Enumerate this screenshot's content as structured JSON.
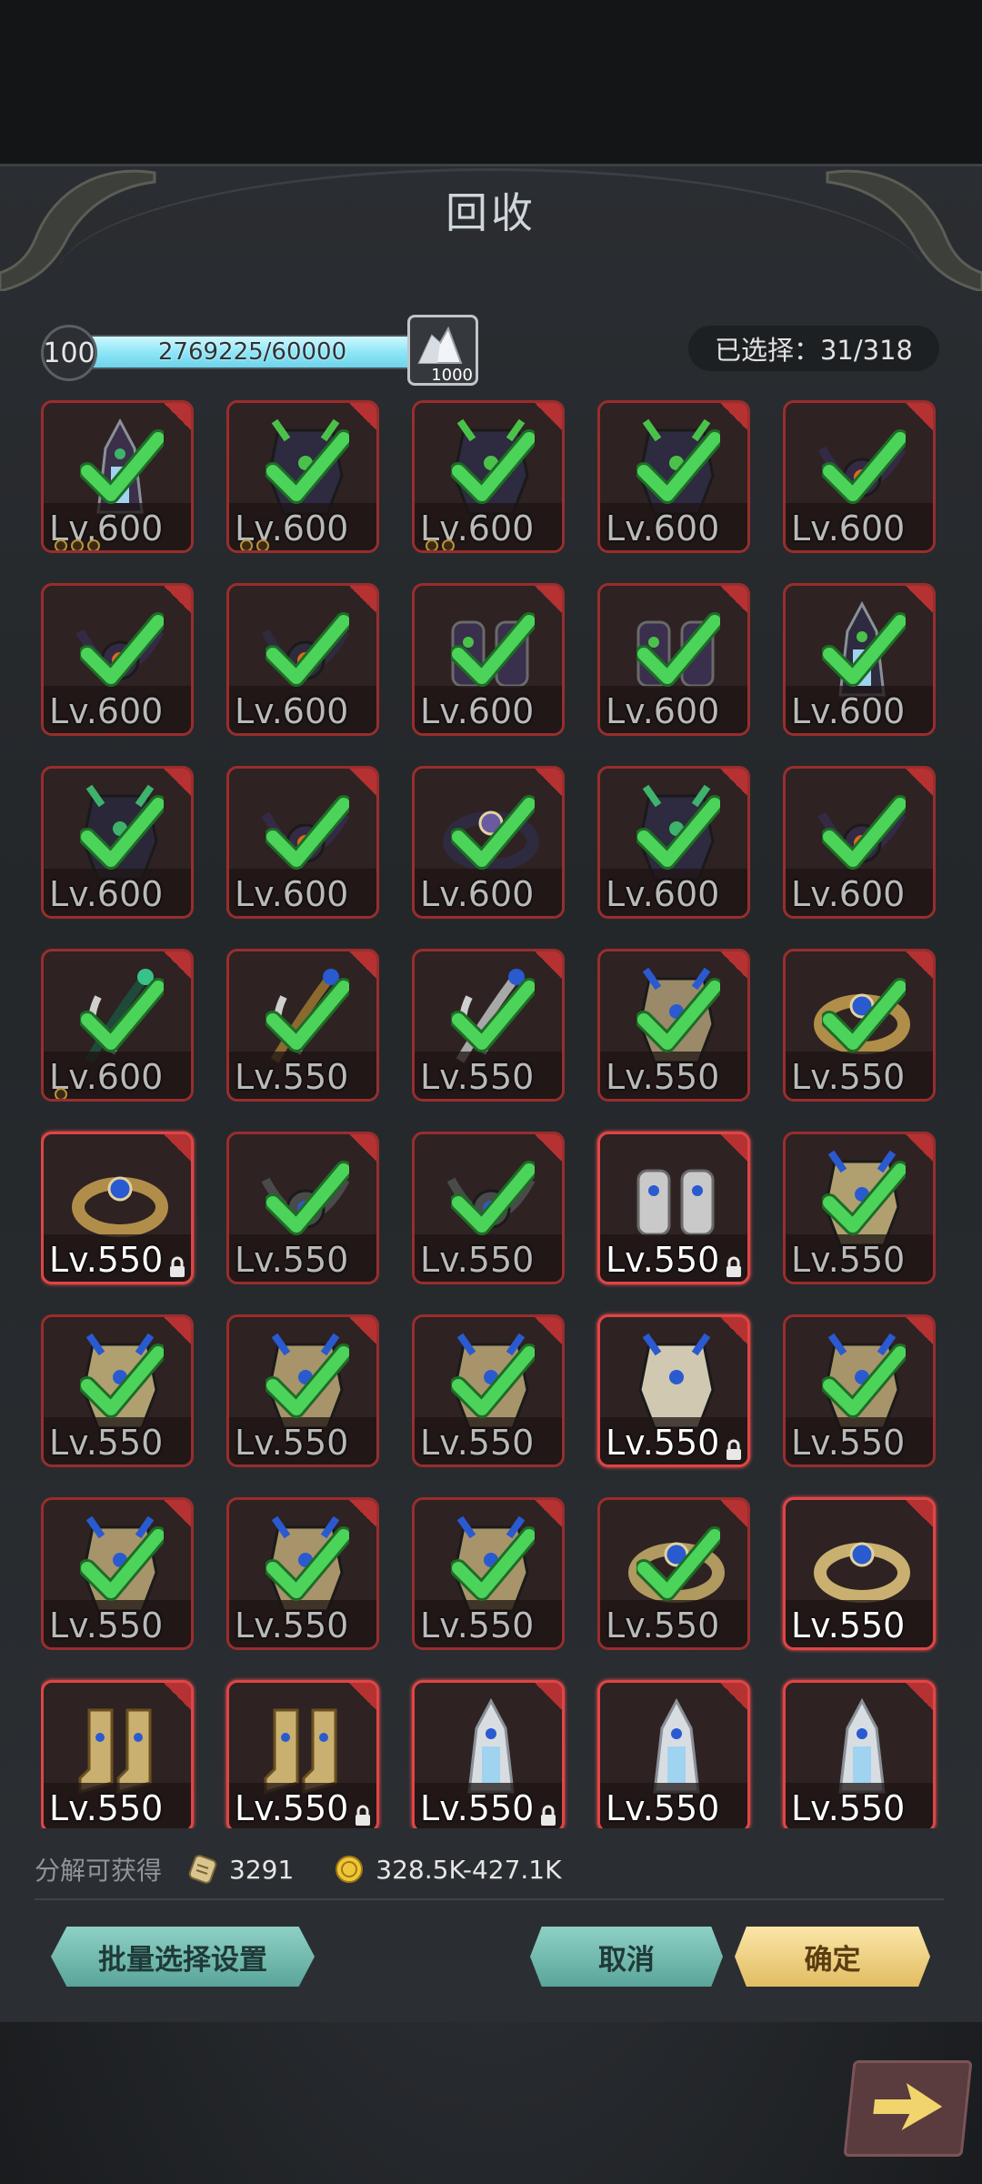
{
  "header": {
    "title": "回收"
  },
  "progress": {
    "level": "100",
    "text": "2769225/60000",
    "fill_fraction": 1.0
  },
  "crystal": {
    "icon": "white-crystal-icon",
    "count": "1000"
  },
  "selection": {
    "label": "已选择：31/318"
  },
  "items": [
    {
      "level": "Lv.600",
      "checked": true,
      "locked": false,
      "icon": "dark-horned-helmet",
      "dots": 3,
      "palette": [
        "#3b2f4a",
        "#3db36b"
      ]
    },
    {
      "level": "Lv.600",
      "checked": true,
      "locked": false,
      "icon": "dark-armor",
      "dots": 2,
      "palette": [
        "#2e2a3f",
        "#4ac24a"
      ]
    },
    {
      "level": "Lv.600",
      "checked": true,
      "locked": false,
      "icon": "dark-armor",
      "dots": 2,
      "palette": [
        "#2e2a3f",
        "#4ac24a"
      ]
    },
    {
      "level": "Lv.600",
      "checked": true,
      "locked": false,
      "icon": "dark-armor",
      "dots": 0,
      "palette": [
        "#2e2a3f",
        "#4ac24a"
      ]
    },
    {
      "level": "Lv.600",
      "checked": true,
      "locked": false,
      "icon": "dark-orb-amulet",
      "dots": 0,
      "palette": [
        "#342a46",
        "#e06a1a"
      ]
    },
    {
      "level": "Lv.600",
      "checked": true,
      "locked": false,
      "icon": "dark-orb-amulet",
      "dots": 0,
      "palette": [
        "#342a46",
        "#e06a1a"
      ]
    },
    {
      "level": "Lv.600",
      "checked": true,
      "locked": false,
      "icon": "dark-necklace",
      "dots": 0,
      "palette": [
        "#2f2a3c",
        "#e06a1a"
      ]
    },
    {
      "level": "Lv.600",
      "checked": true,
      "locked": false,
      "icon": "dark-gauntlet",
      "dots": 0,
      "palette": [
        "#3a2f4c",
        "#4ac24a"
      ]
    },
    {
      "level": "Lv.600",
      "checked": true,
      "locked": false,
      "icon": "dark-gauntlet",
      "dots": 0,
      "palette": [
        "#3a2f4c",
        "#4ac24a"
      ]
    },
    {
      "level": "Lv.600",
      "checked": true,
      "locked": false,
      "icon": "dark-horned-helmet",
      "dots": 0,
      "palette": [
        "#2e2a3f",
        "#4ac24a"
      ]
    },
    {
      "level": "Lv.600",
      "checked": true,
      "locked": false,
      "icon": "dark-leggings",
      "dots": 0,
      "palette": [
        "#2a2838",
        "#3db36b"
      ]
    },
    {
      "level": "Lv.600",
      "checked": true,
      "locked": false,
      "icon": "dark-orb-amulet",
      "dots": 0,
      "palette": [
        "#342a46",
        "#e06a1a"
      ]
    },
    {
      "level": "Lv.600",
      "checked": true,
      "locked": false,
      "icon": "dark-belt",
      "dots": 0,
      "palette": [
        "#2e2a3f",
        "#6a5aa0"
      ]
    },
    {
      "level": "Lv.600",
      "checked": true,
      "locked": false,
      "icon": "dark-chest",
      "dots": 0,
      "palette": [
        "#2e2a3f",
        "#3db36b"
      ]
    },
    {
      "level": "Lv.600",
      "checked": true,
      "locked": false,
      "icon": "dark-orb-amulet",
      "dots": 0,
      "palette": [
        "#342a46",
        "#e06a1a"
      ]
    },
    {
      "level": "Lv.600",
      "checked": true,
      "locked": false,
      "icon": "green-blade",
      "dots": 1,
      "palette": [
        "#1f4a3a",
        "#38c28a"
      ]
    },
    {
      "level": "Lv.550",
      "checked": true,
      "locked": false,
      "icon": "gold-staff",
      "dots": 0,
      "palette": [
        "#8a6a2e",
        "#2a5ad0"
      ]
    },
    {
      "level": "Lv.550",
      "checked": true,
      "locked": false,
      "icon": "silver-crescent",
      "dots": 0,
      "palette": [
        "#a8a8a8",
        "#2a5ad0"
      ]
    },
    {
      "level": "Lv.550",
      "checked": true,
      "locked": false,
      "icon": "gold-armor",
      "dots": 0,
      "palette": [
        "#9a8a6a",
        "#2a5ad0"
      ]
    },
    {
      "level": "Lv.550",
      "checked": true,
      "locked": false,
      "icon": "gold-ring",
      "dots": 0,
      "palette": [
        "#b08e4a",
        "#2a5ad0"
      ]
    },
    {
      "level": "Lv.550",
      "checked": false,
      "locked": true,
      "icon": "gold-ring",
      "dots": 0,
      "palette": [
        "#b08e4a",
        "#2a5ad0"
      ]
    },
    {
      "level": "Lv.550",
      "checked": true,
      "locked": false,
      "icon": "dark-necklace",
      "dots": 0,
      "palette": [
        "#4a4a4a",
        "#2a5ad0"
      ]
    },
    {
      "level": "Lv.550",
      "checked": true,
      "locked": false,
      "icon": "dark-necklace",
      "dots": 0,
      "palette": [
        "#4a4a4a",
        "#2a5ad0"
      ]
    },
    {
      "level": "Lv.550",
      "checked": false,
      "locked": true,
      "icon": "silver-gauntlets",
      "dots": 0,
      "palette": [
        "#c9c9c9",
        "#2a5ad0"
      ]
    },
    {
      "level": "Lv.550",
      "checked": true,
      "locked": false,
      "icon": "moon-amulet",
      "dots": 0,
      "palette": [
        "#b0a070",
        "#2a5ad0"
      ]
    },
    {
      "level": "Lv.550",
      "checked": true,
      "locked": false,
      "icon": "moon-amulet",
      "dots": 0,
      "palette": [
        "#b0a070",
        "#2a5ad0"
      ]
    },
    {
      "level": "Lv.550",
      "checked": true,
      "locked": false,
      "icon": "gold-leggings",
      "dots": 0,
      "palette": [
        "#a8946a",
        "#2a5ad0"
      ]
    },
    {
      "level": "Lv.550",
      "checked": true,
      "locked": false,
      "icon": "gold-leggings",
      "dots": 0,
      "palette": [
        "#a8946a",
        "#2a5ad0"
      ]
    },
    {
      "level": "Lv.550",
      "checked": false,
      "locked": true,
      "icon": "gold-leggings",
      "dots": 0,
      "palette": [
        "#d0c8b0",
        "#2a5ad0"
      ]
    },
    {
      "level": "Lv.550",
      "checked": true,
      "locked": false,
      "icon": "gold-leggings",
      "dots": 0,
      "palette": [
        "#a8946a",
        "#2a5ad0"
      ]
    },
    {
      "level": "Lv.550",
      "checked": true,
      "locked": false,
      "icon": "gold-leggings",
      "dots": 0,
      "palette": [
        "#a8946a",
        "#2a5ad0"
      ]
    },
    {
      "level": "Lv.550",
      "checked": true,
      "locked": false,
      "icon": "gold-leggings",
      "dots": 0,
      "palette": [
        "#a8946a",
        "#2a5ad0"
      ]
    },
    {
      "level": "Lv.550",
      "checked": true,
      "locked": false,
      "icon": "gold-leggings",
      "dots": 0,
      "palette": [
        "#a8946a",
        "#2a5ad0"
      ]
    },
    {
      "level": "Lv.550",
      "checked": true,
      "locked": false,
      "icon": "gold-belt",
      "dots": 0,
      "palette": [
        "#b09a60",
        "#2a5ad0"
      ]
    },
    {
      "level": "Lv.550",
      "checked": false,
      "locked": false,
      "icon": "gold-belt",
      "dots": 0,
      "palette": [
        "#c9b070",
        "#2a5ad0"
      ]
    },
    {
      "level": "Lv.550",
      "checked": false,
      "locked": false,
      "icon": "gold-boots",
      "dots": 0,
      "palette": [
        "#c9b070",
        "#2a5ad0"
      ]
    },
    {
      "level": "Lv.550",
      "checked": false,
      "locked": true,
      "icon": "gold-boots",
      "dots": 0,
      "palette": [
        "#c9b070",
        "#2a5ad0"
      ]
    },
    {
      "level": "Lv.550",
      "checked": false,
      "locked": true,
      "icon": "silver-helmet",
      "dots": 0,
      "palette": [
        "#d8dde2",
        "#2a5ad0"
      ]
    },
    {
      "level": "Lv.550",
      "checked": false,
      "locked": false,
      "icon": "silver-helmet",
      "dots": 0,
      "palette": [
        "#d8dde2",
        "#2a5ad0"
      ]
    },
    {
      "level": "Lv.550",
      "checked": false,
      "locked": false,
      "icon": "silver-helmet",
      "dots": 0,
      "palette": [
        "#d8dde2",
        "#2a5ad0"
      ]
    }
  ],
  "footer": {
    "label": "分解可获得",
    "resource1": {
      "icon": "scroll-icon",
      "value": "3291"
    },
    "resource2": {
      "icon": "gold-coin-icon",
      "value": "328.5K-427.1K"
    }
  },
  "buttons": {
    "batch": "批量选择设置",
    "cancel": "取消",
    "confirm": "确定"
  },
  "colors": {
    "accent_teal": "#6fb8ad",
    "accent_gold": "#ecc878",
    "check_green": "#4cd35a",
    "frame_red": "#9a2d2d"
  }
}
